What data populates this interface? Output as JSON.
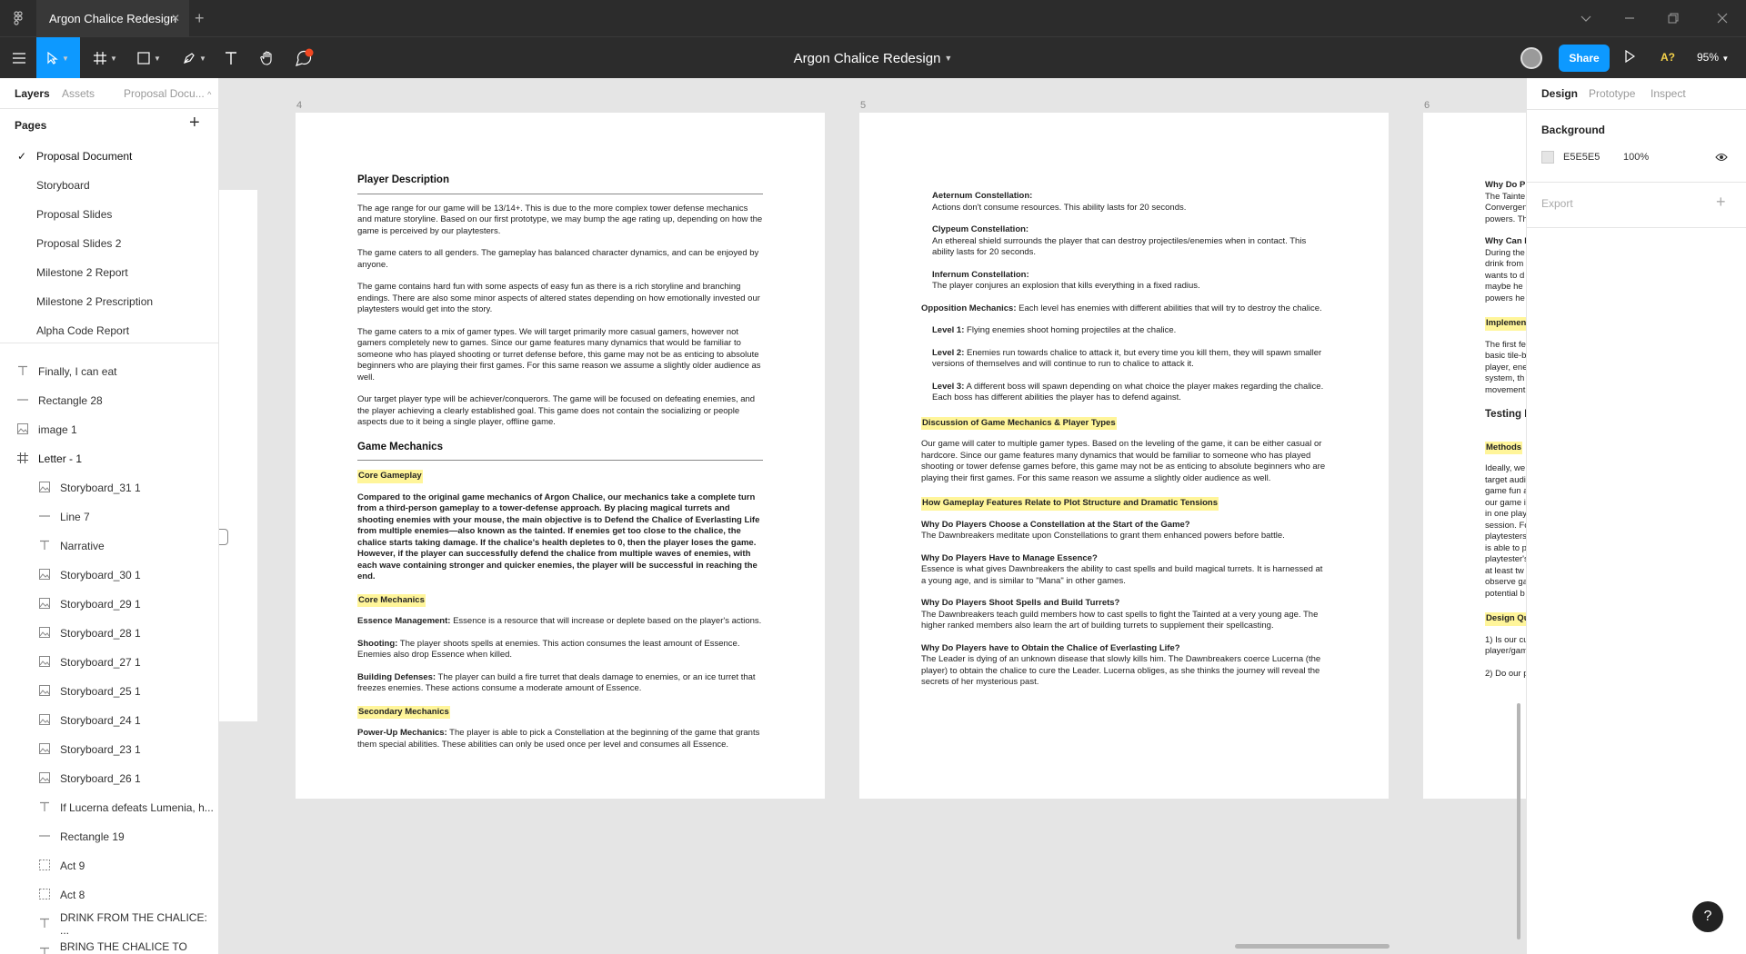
{
  "tabbar": {
    "tab_title": "Argon Chalice Redesign",
    "close": "✕",
    "add": "+"
  },
  "toolbar": {
    "file_title": "Argon Chalice Redesign",
    "share": "Share",
    "zoom": "95%",
    "aq": "A?"
  },
  "left_panel": {
    "tabs": [
      "Layers",
      "Assets",
      "Proposal Docu..."
    ],
    "pages_heading": "Pages",
    "pages": [
      "Proposal Document",
      "Storyboard",
      "Proposal Slides",
      "Proposal Slides 2",
      "Milestone 2 Report",
      "Milestone 2 Prescription",
      "Alpha Code Report"
    ],
    "layers": [
      {
        "icon": "text",
        "name": "Finally, I can eat",
        "indent": 0
      },
      {
        "icon": "line",
        "name": "Rectangle 28",
        "indent": 0
      },
      {
        "icon": "image",
        "name": "image 1",
        "indent": 0
      },
      {
        "icon": "frame",
        "name": "Letter - 1",
        "indent": 0
      },
      {
        "icon": "image",
        "name": "Storyboard_31 1",
        "indent": 1
      },
      {
        "icon": "line",
        "name": "Line 7",
        "indent": 1
      },
      {
        "icon": "text",
        "name": "Narrative",
        "indent": 1
      },
      {
        "icon": "image",
        "name": "Storyboard_30 1",
        "indent": 1
      },
      {
        "icon": "image",
        "name": "Storyboard_29 1",
        "indent": 1
      },
      {
        "icon": "image",
        "name": "Storyboard_28 1",
        "indent": 1
      },
      {
        "icon": "image",
        "name": "Storyboard_27 1",
        "indent": 1
      },
      {
        "icon": "image",
        "name": "Storyboard_25 1",
        "indent": 1
      },
      {
        "icon": "image",
        "name": "Storyboard_24 1",
        "indent": 1
      },
      {
        "icon": "image",
        "name": "Storyboard_23 1",
        "indent": 1
      },
      {
        "icon": "image",
        "name": "Storyboard_26 1",
        "indent": 1
      },
      {
        "icon": "text",
        "name": "If Lucerna defeats Lumenia, h...",
        "indent": 1
      },
      {
        "icon": "line",
        "name": "Rectangle 19",
        "indent": 1
      },
      {
        "icon": "group",
        "name": "Act 9",
        "indent": 1
      },
      {
        "icon": "group",
        "name": "Act 8",
        "indent": 1
      },
      {
        "icon": "text",
        "name": "DRINK FROM THE CHALICE: ...",
        "indent": 1
      },
      {
        "icon": "text",
        "name": "BRING THE CHALICE TO THE...",
        "indent": 1
      }
    ]
  },
  "canvas": {
    "frame_labels": [
      "4",
      "5",
      "6"
    ],
    "page4": {
      "h_player": "Player Description",
      "p1": "The age range for our game will be 13/14+. This is due to the more complex tower defense mechanics and mature storyline. Based on our first prototype, we may bump the age rating up, depending on how the game is perceived by our playtesters.",
      "p2": "The game caters to all genders. The gameplay has balanced character dynamics, and can be enjoyed by anyone.",
      "p3": "The game contains hard fun with some aspects of easy fun as there is a rich storyline and branching endings. There are also some minor aspects of altered states depending on how emotionally invested our playtesters would get into the story.",
      "p4": "The game caters to a mix of gamer types. We will target primarily more casual gamers, however not gamers completely new to games. Since our game features many dynamics that would be familiar to someone who has played shooting or turret defense before, this game may not be as enticing to absolute beginners who are playing their first games. For this same reason we assume a slightly older audience as well.",
      "p5": "Our target player type will be achiever/conquerors. The game will be focused on defeating enemies, and the player achieving a clearly established goal. This game does not contain the socializing or people aspects due to it being a single player, offline game.",
      "h_mech": "Game Mechanics",
      "hl_core_gameplay": "Core Gameplay",
      "core_gameplay": "Compared to the original game mechanics of Argon Chalice, our mechanics take a complete turn from a third-person gameplay to a tower-defense approach. By placing magical turrets and shooting enemies with your mouse, the main objective is to Defend the Chalice of Everlasting Life from multiple enemies—also known as the tainted. If enemies get too close to the chalice, the chalice starts taking damage. If the chalice's health depletes to 0, then the player loses the game. However, if the player can successfully defend the chalice from multiple waves of enemies, with each wave containing stronger and quicker enemies, the player will be successful in reaching the end.",
      "hl_core_mech": "Core Mechanics",
      "essence_label": "Essence Management:",
      "essence": " Essence is a resource that will increase or deplete based on the player's actions.",
      "shooting_label": "Shooting:",
      "shooting": " The player shoots spells at enemies. This action consumes the least amount of Essence. Enemies also drop Essence when killed.",
      "building_label": "Building Defenses:",
      "building": " The player can build a fire turret that deals damage to enemies, or an ice turret that freezes enemies. These actions consume a moderate amount of Essence.",
      "hl_secondary": "Secondary Mechanics",
      "powerup_label": "Power-Up Mechanics:",
      "powerup": " The player is able to pick a Constellation at the beginning of the game that grants them special abilities. These abilities can only be used once per level and consumes all Essence."
    },
    "page5": {
      "aet_label": "Aeternum Constellation:",
      "aet": "Actions don't consume resources. This ability lasts for 20 seconds.",
      "cly_label": "Clypeum Constellation:",
      "cly": "An ethereal shield surrounds the player that can destroy projectiles/enemies when in contact. This ability lasts for 20 seconds.",
      "inf_label": "Infernum Constellation:",
      "inf": "The player conjures an explosion that kills everything in a fixed radius.",
      "opp_label": "Opposition Mechanics:",
      "opp": " Each level has enemies with different abilities that will try to destroy the chalice.",
      "l1_label": "Level 1:",
      "l1": " Flying enemies shoot homing projectiles at the chalice.",
      "l2_label": "Level 2:",
      "l2": " Enemies run towards chalice to attack it, but every time you kill them, they will spawn smaller versions of themselves and will continue to run to chalice to attack it.",
      "l3_label": "Level 3:",
      "l3": " A different boss will spawn depending on what choice the player makes regarding the chalice. Each boss has different abilities the player has to defend against.",
      "hl_discussion": "Discussion of Game Mechanics & Player Types",
      "discussion": "Our game will cater to multiple gamer types. Based on the leveling of the game, it can be either casual or hardcore. Since our game features many dynamics that would be familiar to someone who has played shooting or tower defense games before, this game may not be as enticing to absolute beginners who are playing their first games. For this same reason we assume a slightly older audience as well.",
      "hl_plot": "How Gameplay Features Relate to Plot Structure and Dramatic Tensions",
      "q1": "Why Do Players Choose a Constellation at the Start of the Game?",
      "a1": "The Dawnbreakers meditate upon Constellations to grant them enhanced powers before battle.",
      "q2": "Why Do Players Have to Manage Essence?",
      "a2": "Essence is what gives Dawnbreakers the ability to cast spells and build magical turrets. It is harnessed at a young age, and is similar to \"Mana\" in other games.",
      "q3": "Why Do Players Shoot Spells and Build Turrets?",
      "a3": "The Dawnbreakers teach guild members how to cast spells to fight the Tainted at a very young age. The higher ranked members also learn the art of building turrets to supplement their spellcasting.",
      "q4": "Why Do Players have to Obtain the Chalice of Everlasting Life?",
      "a4": "The Leader is dying of an unknown disease that slowly kills him. The Dawnbreakers coerce Lucerna (the player) to obtain the chalice to cure the Leader. Lucerna obliges, as she thinks the journey will reveal the secrets of her mysterious past."
    },
    "page6": {
      "q_a": "Why Do Pla",
      "t_a1": "The Tainte",
      "t_a2": "Convergen",
      "t_a3": "powers. Th",
      "q_b": "Why Can P",
      "t_b1": "During the",
      "t_b2": "drink from",
      "t_b3": "wants to d",
      "t_b4": "maybe he",
      "t_b5": "powers he",
      "hl_impl": "Implement",
      "t_c1": "The first fe",
      "t_c2": "basic tile-b",
      "t_c3": "player, ene",
      "t_c4": "system, th",
      "t_c5": "movement",
      "h_testing": "Testing I",
      "hl_methods": "Methods",
      "t_d1": "Ideally, we",
      "t_d2": "target audi",
      "t_d3": "game fun a",
      "t_d4": "our game i",
      "t_d5": "in one play",
      "t_d6": "session. Fo",
      "t_d7": "playtesters",
      "t_d8": "is able to p",
      "t_d9": "playtester's",
      "t_d10": "at least tw",
      "t_d11": "observe ga",
      "t_d12": "potential b",
      "hl_design": "Design Qu",
      "t_e1": "1) Is our cu",
      "t_e2": "player/gam",
      "t_e3": "2) Do our p"
    }
  },
  "right_panel": {
    "tabs": [
      "Design",
      "Prototype",
      "Inspect"
    ],
    "background_heading": "Background",
    "bg_hex": "E5E5E5",
    "bg_opacity": "100%",
    "export_heading": "Export",
    "export_add": "+"
  },
  "help": "?"
}
